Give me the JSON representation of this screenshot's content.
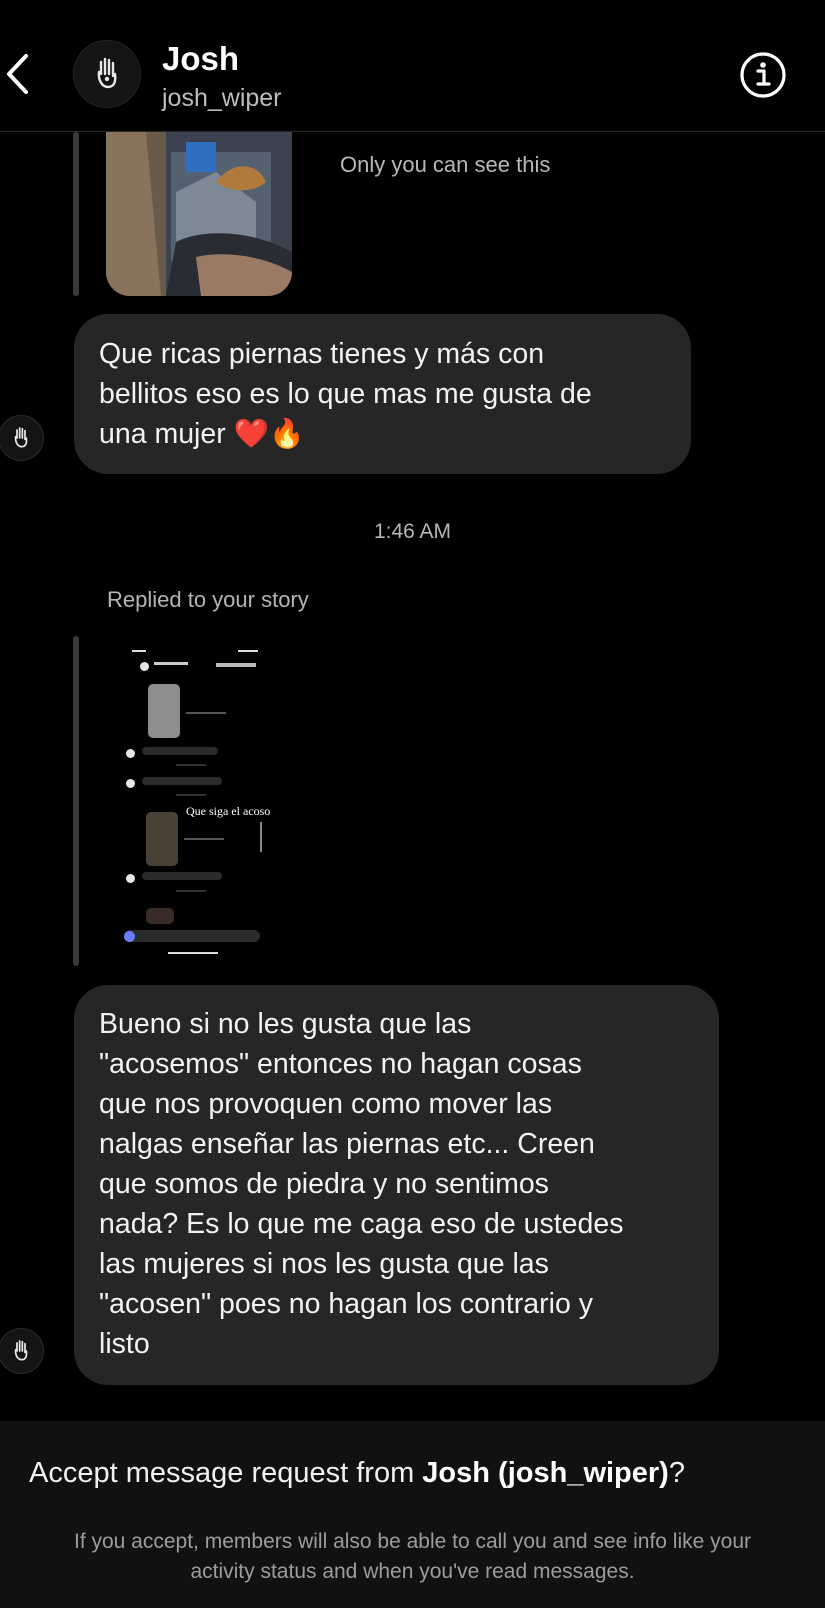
{
  "header": {
    "name": "Josh",
    "username": "josh_wiper"
  },
  "thread": {
    "only_you_label": "Only you can see this",
    "messages": [
      {
        "text": "Que ricas piernas tienes y más con\nbellitos eso es lo que mas me gusta de\nuna mujer ❤️🔥"
      },
      {
        "text": "Bueno si no les gusta que las\n\"acosemos\" entonces no hagan cosas\nque nos provoquen como mover las\nnalgas enseñar las piernas etc... Creen\nque somos de piedra y no sentimos\nnada? Es lo que me caga eso de ustedes\nlas mujeres si nos les gusta que las\n\"acosen\" poes no hagan los  contrario y\nlisto"
      }
    ],
    "timestamp": "1:46 AM",
    "replied_label": "Replied to your story",
    "story_caption": "Que siga el acoso"
  },
  "footer": {
    "accept_prefix": "Accept message request from ",
    "accept_name": "Josh (josh_wiper)",
    "accept_suffix": "?",
    "note": "If you accept, members will also be able to call you and see info like your activity status and when you've read messages."
  },
  "icons": {
    "back": "chevron-left-icon",
    "info": "info-circle-icon",
    "avatar": "hand-sketch-avatar-icon"
  },
  "colors": {
    "background": "#000000",
    "bubble": "#262626",
    "footer": "#111111",
    "secondary_text": "#b5b5b5"
  }
}
